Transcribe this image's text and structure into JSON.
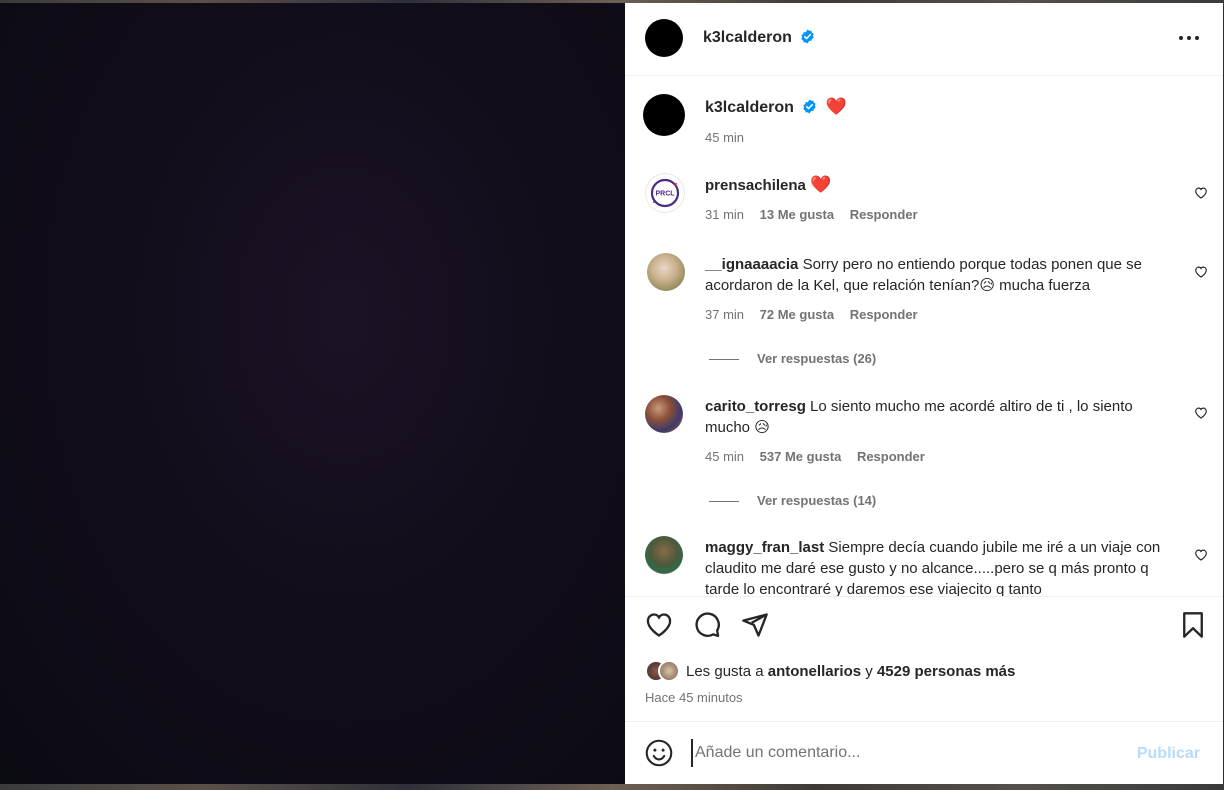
{
  "post": {
    "author": "k3lcalderon",
    "caption_emoji": "❤️",
    "caption_time": "45 min"
  },
  "comments": [
    {
      "user": "prensachilena",
      "text": "❤️",
      "time": "31 min",
      "likes": "13 Me gusta",
      "reply_label": "Responder",
      "avatar_text": "PRCL"
    },
    {
      "user": "__ignaaaacia",
      "text": "Sorry pero no entiendo porque todas ponen que se acordaron de la Kel, que relación tenían?😥 mucha fuerza",
      "time": "37 min",
      "likes": "72 Me gusta",
      "reply_label": "Responder",
      "view_replies": "Ver respuestas (26)"
    },
    {
      "user": "carito_torresg",
      "text": "Lo siento mucho me acordé altiro de ti , lo siento mucho 😥",
      "time": "45 min",
      "likes": "537 Me gusta",
      "reply_label": "Responder",
      "view_replies": "Ver respuestas (14)"
    },
    {
      "user": "maggy_fran_last",
      "text": "Siempre decía cuando jubile me iré a un viaje con claudito me daré ese gusto y no alcance.....pero se q más pronto q tarde lo encontraré y daremos ese viajecito q tanto"
    }
  ],
  "likes_summary": {
    "prefix": "Les gusta a",
    "first_user": "antonellarios",
    "connector": "y",
    "others": "4529 personas más"
  },
  "time_ago": "Hace 45 minutos",
  "composer": {
    "placeholder": "Añade un comentario...",
    "publish_label": "Publicar"
  },
  "colors": {
    "verified": "#0095f6",
    "heart": "#e0162b",
    "publish_disabled": "#b7dbfb"
  }
}
